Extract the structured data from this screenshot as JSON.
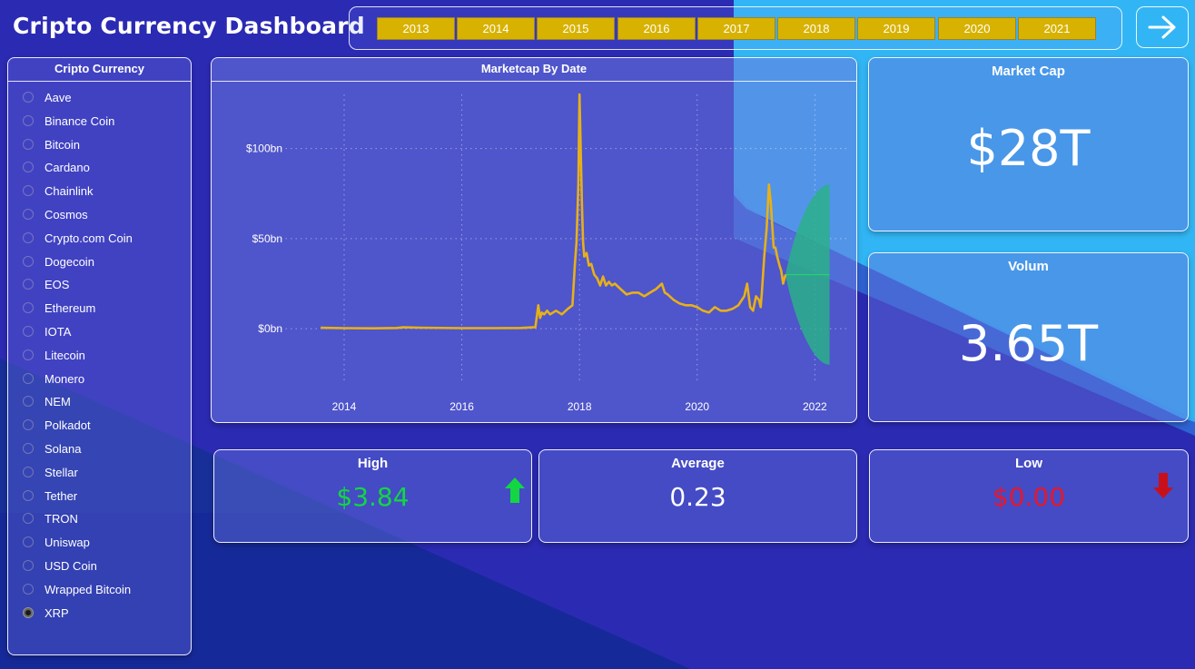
{
  "title": "Cripto Currency Dashboard",
  "years": [
    "2013",
    "2014",
    "2015",
    "2016",
    "2017",
    "2018",
    "2019",
    "2020",
    "2021"
  ],
  "nav_icon": "arrow-right-icon",
  "slicer": {
    "title": "Cripto Currency",
    "items": [
      "Aave",
      "Binance Coin",
      "Bitcoin",
      "Cardano",
      "Chainlink",
      "Cosmos",
      "Crypto.com Coin",
      "Dogecoin",
      "EOS",
      "Ethereum",
      "IOTA",
      "Litecoin",
      "Monero",
      "NEM",
      "Polkadot",
      "Solana",
      "Stellar",
      "Tether",
      "TRON",
      "Uniswap",
      "USD Coin",
      "Wrapped Bitcoin",
      "XRP"
    ],
    "selected": "XRP"
  },
  "kpis": {
    "market_cap": {
      "label": "Market Cap",
      "value": "$28T"
    },
    "volume": {
      "label": "Volum",
      "value": "3.65T"
    },
    "high": {
      "label": "High",
      "value": "$3.84",
      "color": "#13d643"
    },
    "average": {
      "label": "Average",
      "value": "0.23"
    },
    "low": {
      "label": "Low",
      "value": "$0.00",
      "color": "#e8172b"
    }
  },
  "colors": {
    "background": "#2b2ab3",
    "line": "#e7b019",
    "forecast": "#2ab08a",
    "year_button": "#d8b200",
    "up_arrow": "#13d643",
    "down_arrow": "#c8101a"
  },
  "chart_data": {
    "type": "line",
    "title": "Marketcap By Date",
    "xlabel": "",
    "ylabel": "",
    "x_ticks": [
      "2014",
      "2016",
      "2018",
      "2020",
      "2022"
    ],
    "y_ticks": [
      "$0bn",
      "$50bn",
      "$100bn"
    ],
    "xlim": [
      2012.75,
      2022.55
    ],
    "ylim": [
      -10,
      130
    ],
    "grid": true,
    "series": [
      {
        "x": [
          2013.6,
          2014.0,
          2014.5,
          2014.9,
          2015.0,
          2015.3,
          2016.0,
          2016.5,
          2017.0,
          2017.25,
          2017.3,
          2017.33,
          2017.36,
          2017.4,
          2017.45,
          2017.5,
          2017.6,
          2017.7,
          2017.8,
          2017.88,
          2017.92,
          2017.95,
          2017.98,
          2018.0,
          2018.02,
          2018.04,
          2018.06,
          2018.08,
          2018.12,
          2018.16,
          2018.2,
          2018.25,
          2018.3,
          2018.35,
          2018.4,
          2018.45,
          2018.5,
          2018.55,
          2018.6,
          2018.7,
          2018.8,
          2018.9,
          2019.0,
          2019.1,
          2019.2,
          2019.3,
          2019.4,
          2019.45,
          2019.5,
          2019.6,
          2019.7,
          2019.8,
          2019.9,
          2020.0,
          2020.1,
          2020.2,
          2020.3,
          2020.4,
          2020.5,
          2020.6,
          2020.7,
          2020.8,
          2020.85,
          2020.9,
          2020.95,
          2021.0,
          2021.05,
          2021.08,
          2021.1,
          2021.14,
          2021.18,
          2021.22,
          2021.25,
          2021.28,
          2021.3,
          2021.33,
          2021.36,
          2021.4,
          2021.43,
          2021.46,
          2021.5
        ],
        "y": [
          0.5,
          0.3,
          0.2,
          0.4,
          0.8,
          0.6,
          0.3,
          0.3,
          0.4,
          0.9,
          13,
          6,
          9,
          8,
          10,
          8,
          10,
          8,
          11,
          13,
          35,
          48,
          80,
          130,
          100,
          70,
          48,
          40,
          42,
          35,
          36,
          30,
          28,
          24,
          29,
          24,
          26,
          24,
          25,
          22,
          19,
          20,
          20,
          18,
          20,
          22,
          25,
          20,
          19,
          16,
          14,
          13,
          13,
          12,
          10,
          9,
          12,
          10,
          10,
          11,
          13,
          18,
          25,
          12,
          10,
          18,
          16,
          12,
          20,
          40,
          55,
          80,
          70,
          55,
          45,
          45,
          40,
          35,
          32,
          25,
          30
        ]
      }
    ],
    "forecast": {
      "x_start": 2021.5,
      "x_end": 2022.25,
      "mid": 30,
      "upper": 80,
      "lower": -20
    }
  }
}
